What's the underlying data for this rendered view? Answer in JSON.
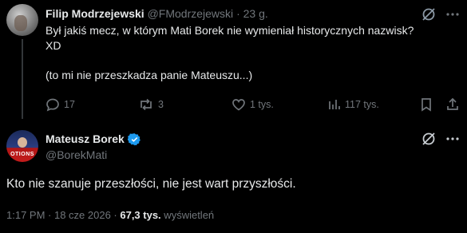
{
  "reply": {
    "name": "Filip Modrzejewski",
    "handle": "@FModrzejewski",
    "sep": "·",
    "age": "23 g.",
    "text": "Był jakiś mecz, w którym Mati Borek nie wymieniał historycznych nazwisk?\nXD\n\n(to mi nie przeszkadza panie Mateuszu...)",
    "replies": "17",
    "reposts": "3",
    "likes": "1 tys.",
    "views": "117 tys."
  },
  "main": {
    "name": "Mateusz Borek",
    "handle": "@BorekMati",
    "avatar_caption": "OTIONS",
    "text": "Kto nie szanuje przeszłości, nie jest wart przyszłości.",
    "time": "1:17 PM · 18 cze 2026 · ",
    "views_count": "67,3 tys.",
    "views_label": " wyświetleń"
  },
  "icons": {
    "grok": "grok-slash-circle-icon",
    "more": "more-dots-icon",
    "verified": "verified-badge-icon",
    "verified_color": "#1d9bf0"
  }
}
